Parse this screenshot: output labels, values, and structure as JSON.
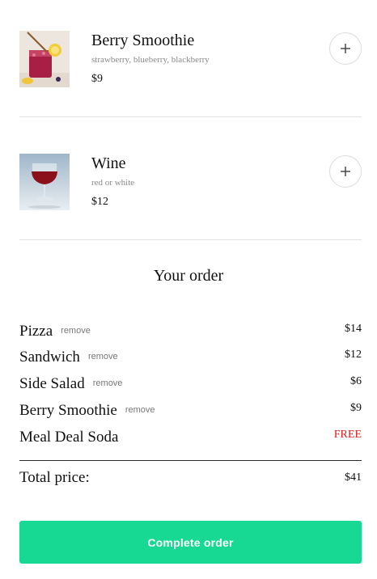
{
  "menu": {
    "items": [
      {
        "name": "Berry Smoothie",
        "description": "strawberry, blueberry, blackberry",
        "price": "$9",
        "image": "berry-smoothie-photo"
      },
      {
        "name": "Wine",
        "description": "red or white",
        "price": "$12",
        "image": "wine-glass-photo"
      }
    ],
    "add_icon": "plus-icon"
  },
  "order": {
    "title": "Your order",
    "remove_label": "remove",
    "items": [
      {
        "name": "Pizza",
        "price": "$14"
      },
      {
        "name": "Sandwich",
        "price": "$12"
      },
      {
        "name": "Side Salad",
        "price": "$6"
      },
      {
        "name": "Berry Smoothie",
        "price": "$9"
      },
      {
        "name": "Meal Deal Soda",
        "price": "FREE"
      }
    ],
    "total_label": "Total price:",
    "total_value": "$41",
    "complete_label": "Complete order"
  },
  "colors": {
    "accent": "#18d994",
    "free": "#e0191b",
    "muted": "#8a8a8a"
  }
}
